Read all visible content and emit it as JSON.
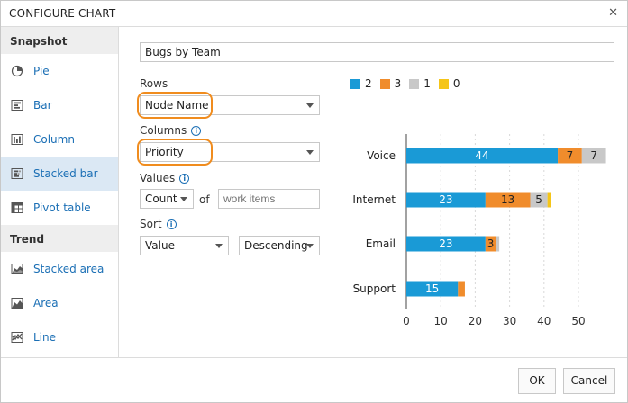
{
  "dialog": {
    "title": "CONFIGURE CHART",
    "close_glyph": "✕",
    "ok_label": "OK",
    "cancel_label": "Cancel"
  },
  "sidebar": {
    "snapshot_header": "Snapshot",
    "trend_header": "Trend",
    "snapshot_items": [
      {
        "label": "Pie",
        "icon": "pie-chart-icon"
      },
      {
        "label": "Bar",
        "icon": "bar-chart-icon"
      },
      {
        "label": "Column",
        "icon": "column-chart-icon"
      },
      {
        "label": "Stacked bar",
        "icon": "stacked-bar-icon",
        "selected": true
      },
      {
        "label": "Pivot table",
        "icon": "pivot-table-icon"
      }
    ],
    "trend_items": [
      {
        "label": "Stacked area",
        "icon": "stacked-area-icon"
      },
      {
        "label": "Area",
        "icon": "area-chart-icon"
      },
      {
        "label": "Line",
        "icon": "line-chart-icon"
      }
    ]
  },
  "form": {
    "chart_title_value": "Bugs by Team",
    "rows_label": "Rows",
    "rows_value": "Node Name",
    "columns_label": "Columns",
    "columns_value": "Priority",
    "values_label": "Values",
    "values_agg": "Count",
    "values_of": "of",
    "values_field_placeholder": "work items",
    "sort_label": "Sort",
    "sort_by": "Value",
    "sort_order": "Descending",
    "info_glyph": "i"
  },
  "colors": {
    "accent": "#1b6fb5",
    "highlight": "#f08c1e",
    "selected_bg": "#dbe8f4"
  },
  "chart_data": {
    "type": "bar",
    "orientation": "horizontal",
    "stacked": true,
    "categories": [
      "Voice",
      "Internet",
      "Email",
      "Support"
    ],
    "series": [
      {
        "name": "2",
        "color": "#1a9ad6",
        "values": [
          44,
          23,
          23,
          15
        ]
      },
      {
        "name": "3",
        "color": "#f08c2c",
        "values": [
          7,
          13,
          3,
          2
        ]
      },
      {
        "name": "1",
        "color": "#c8c8c8",
        "values": [
          7,
          5,
          1,
          0
        ]
      },
      {
        "name": "0",
        "color": "#f5c518",
        "values": [
          0,
          1,
          0,
          0
        ]
      }
    ],
    "xlim": [
      0,
      55
    ],
    "xticks": [
      0,
      10,
      20,
      30,
      40,
      50
    ],
    "grid": true,
    "legend": "top"
  }
}
